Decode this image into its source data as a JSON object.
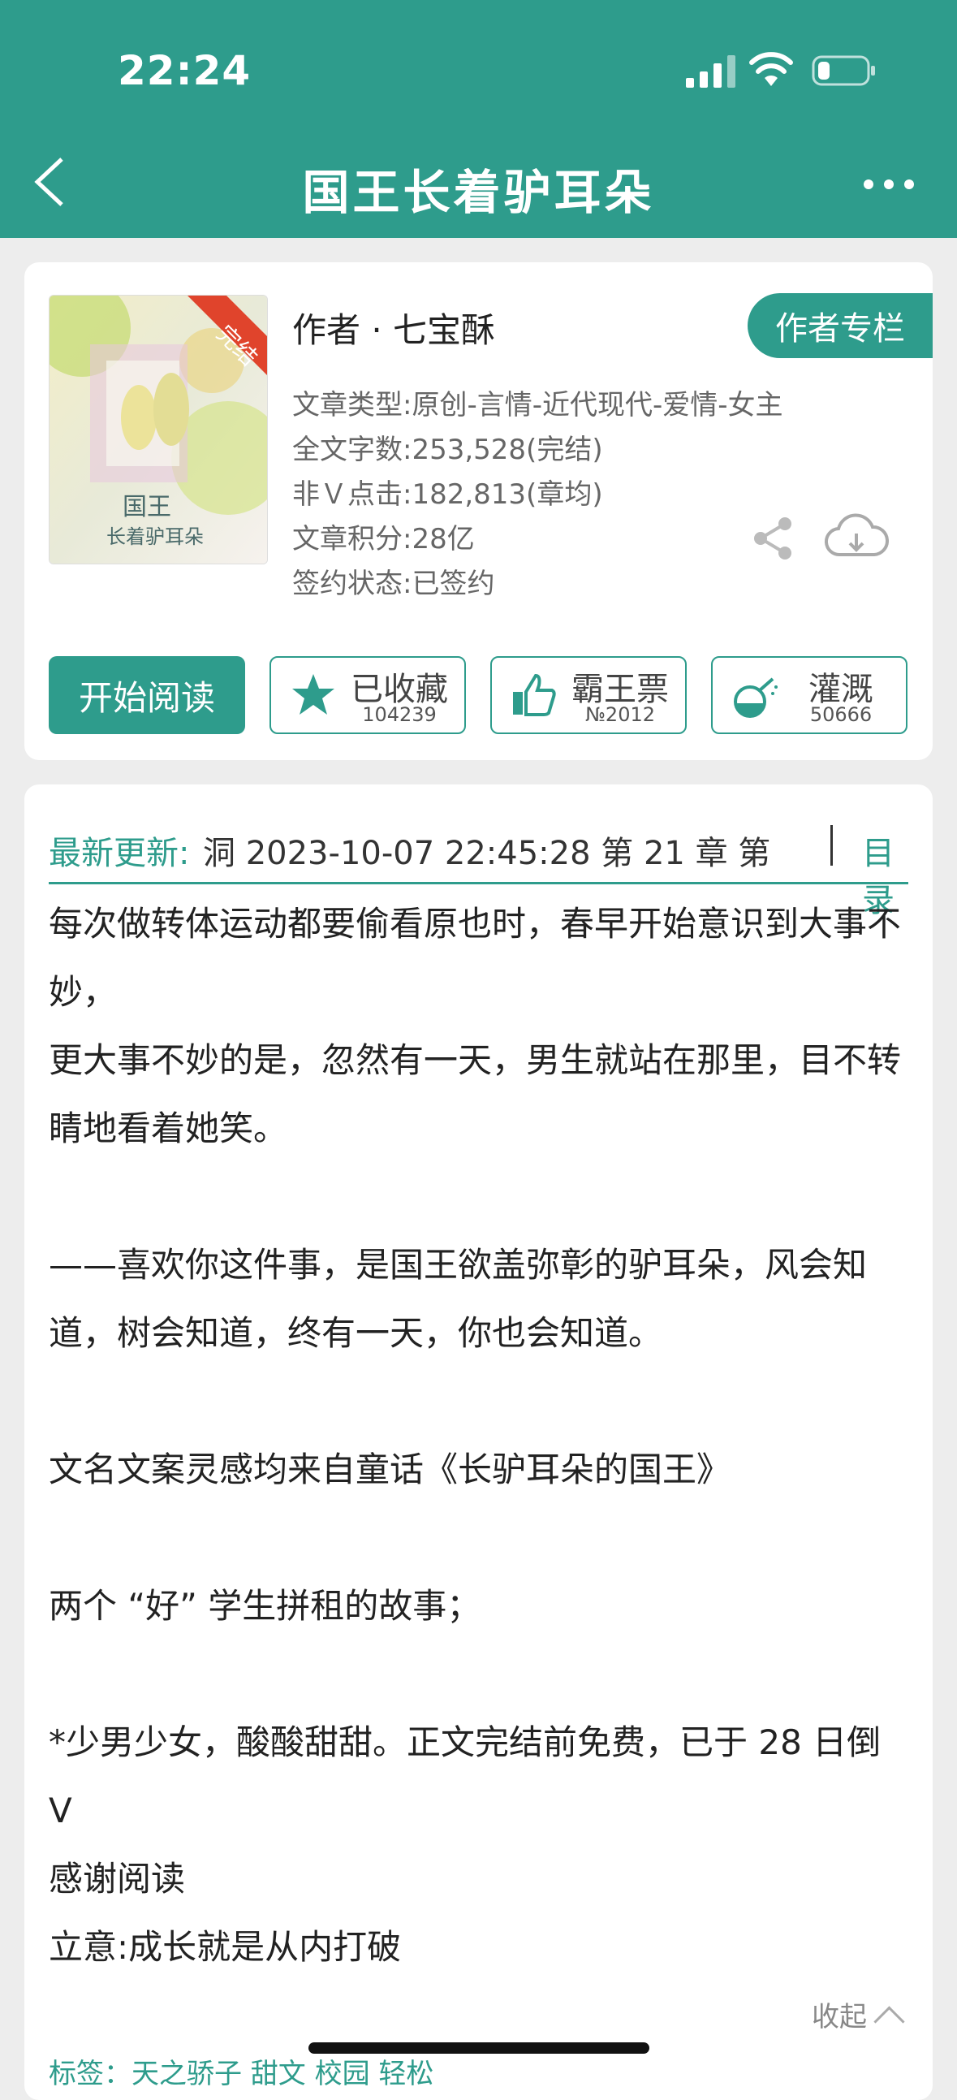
{
  "status_bar": {
    "time": "22:24"
  },
  "header": {
    "title": "国王长着驴耳朵"
  },
  "book": {
    "cover_badge": "完结",
    "author_line": "作者 · 七宝酥",
    "author_column_button": "作者专栏",
    "meta": [
      "文章类型:原创-言情-近代现代-爱情-女主",
      "全文字数:253,528(完结)",
      "非Ｖ点击:182,813(章均)",
      "文章积分:28亿",
      "签约状态:已签约"
    ]
  },
  "actions": {
    "start_reading": "开始阅读",
    "favorite": {
      "label": "已收藏",
      "count": "104239"
    },
    "ticket": {
      "label": "霸王票",
      "count": "№2012"
    },
    "water": {
      "label": "灌溉",
      "count": "50666"
    }
  },
  "update": {
    "label": "最新更新:",
    "text": "洞 2023-10-07 22:45:28   第 21 章  第",
    "toc": "目录"
  },
  "description": [
    "每次做转体运动都要偷看原也时，春早开始意识到大事不妙，",
    "更大事不妙的是，忽然有一天，男生就站在那里，目不转睛地看着她笑。",
    "",
    "——喜欢你这件事，是国王欲盖弥彰的驴耳朵，风会知道，树会知道，终有一天，你也会知道。",
    "",
    "文名文案灵感均来自童话《长驴耳朵的国王》",
    "",
    "两个 “好” 学生拼租的故事；",
    "",
    "*少男少女，酸酸甜甜。正文完结前免费，已于 28 日倒 V",
    "感谢阅读",
    "立意:成长就是从内打破"
  ],
  "collapse_label": "收起",
  "tags_line": "标签：天之骄子  甜文  校园  轻松",
  "colors": {
    "accent": "#2e9c8c",
    "background": "#ededed"
  }
}
